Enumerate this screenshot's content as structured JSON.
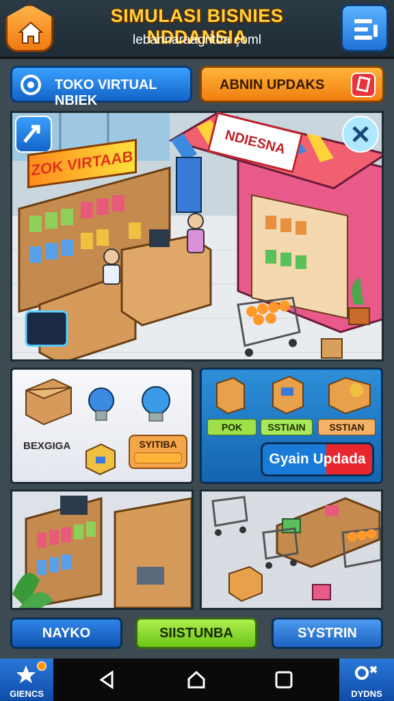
{
  "header": {
    "title": "SIMULASI BISNIES NDDANSIA",
    "subtitle": "lebannaraagritba çoml"
  },
  "actions": {
    "virtual_store": "TOKO VIRTUAL NBIEK",
    "updates": "ABNIN UPDAKS"
  },
  "scene": {
    "neon_sign": "ZOK VIRTAAB",
    "shop_sign": "NDIESNA"
  },
  "left_panel": {
    "label": "BEXGIGA",
    "tag": "SYITIBA"
  },
  "right_panel": {
    "tags": [
      "POK",
      "SSTIAIN",
      "SSTIAN"
    ],
    "update_button": "Gyain Updada"
  },
  "tabs": [
    "NAYKO",
    "SIISTUNBA",
    "SYSTRIN"
  ],
  "navbar": {
    "left_label": "GIENCS",
    "right_label": "DYDNS"
  },
  "colors": {
    "accent_orange": "#f07f10",
    "accent_blue": "#1464c8",
    "accent_green": "#6cc418",
    "title_yellow": "#ffd23a"
  }
}
